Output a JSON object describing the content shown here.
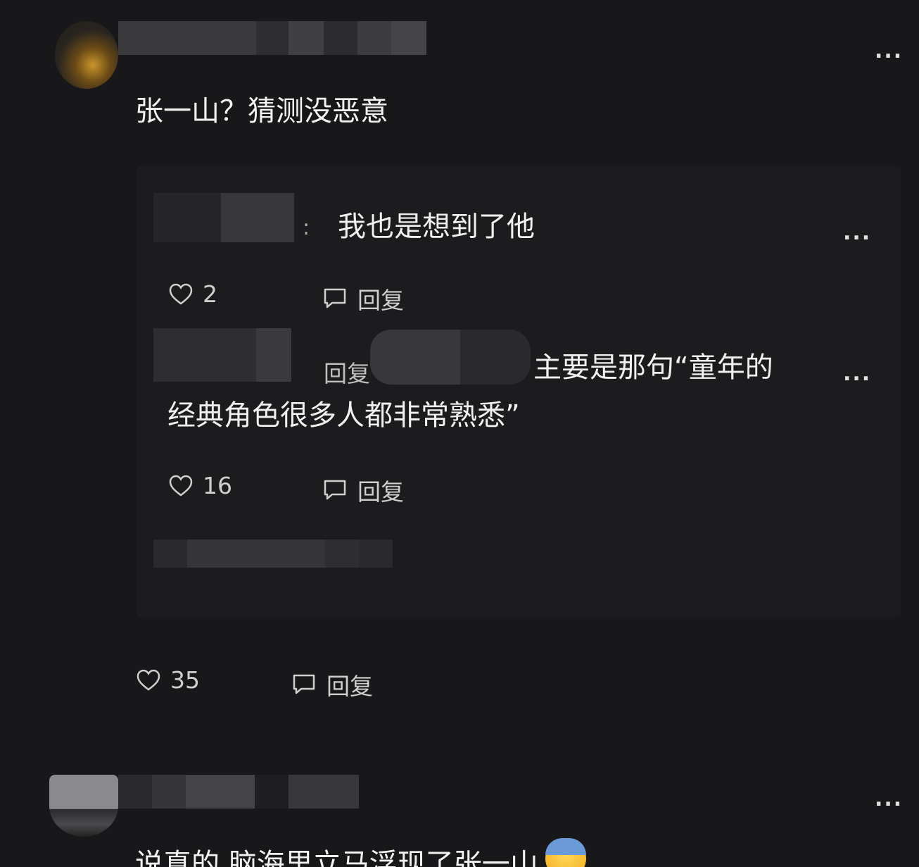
{
  "comment1": {
    "text": "张一山？猜测没恶意",
    "more": "...",
    "likes": "35",
    "reply_label": "回复"
  },
  "reply1": {
    "sep": ":",
    "text": "我也是想到了他",
    "more": "...",
    "likes": "2",
    "reply_label": "回复"
  },
  "reply2": {
    "prefix": "回复",
    "text_line1": "主要是那句“童年的",
    "text_line2": "经典角色很多人都非常熟悉”",
    "more": "...",
    "likes": "16",
    "reply_label": "回复"
  },
  "comment2": {
    "text": "说真的 脑海里立马浮现了张一山",
    "emoji": "scared-face",
    "more": "..."
  },
  "colors": {
    "background": "#18181a",
    "panel": "#1c1c1e",
    "text": "#f2f2f2",
    "muted": "#c8c8c8"
  }
}
